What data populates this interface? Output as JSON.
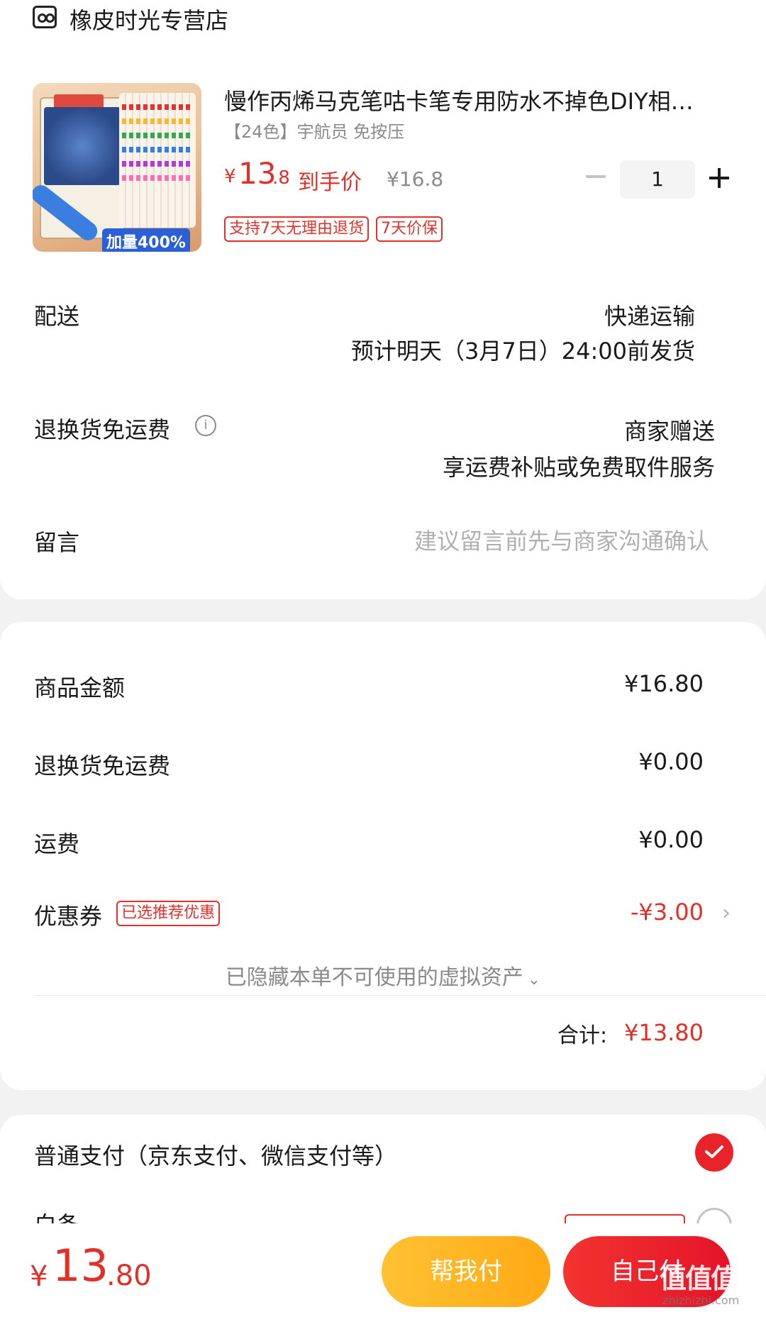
{
  "shop": {
    "name": "橡皮时光专营店",
    "icon": "shop-icon"
  },
  "product": {
    "title": "慢作丙烯马克笔咕卡笔专用防水不掉色DIY相…",
    "spec": "【24色】宇航员 免按压",
    "price_currency": "¥",
    "price_int": "13",
    "price_dec": ".8",
    "price_label": "到手价",
    "original_price": "¥16.8",
    "quantity": "1",
    "image_badge": "加量400%",
    "tags": [
      "支持7天无理由退货",
      "7天价保"
    ]
  },
  "delivery": {
    "label": "配送",
    "method": "快递运输",
    "eta": "预计明天（3月7日）24:00前发货"
  },
  "exchange_freight": {
    "label": "退换货免运费",
    "value": "商家赠送",
    "desc": "享运费补贴或免费取件服务"
  },
  "message": {
    "label": "留言",
    "placeholder": "建议留言前先与商家沟通确认"
  },
  "summary": {
    "goods_amount_label": "商品金额",
    "goods_amount_value": "¥16.80",
    "exchange_fee_label": "退换货免运费",
    "exchange_fee_value": "¥0.00",
    "shipping_label": "运费",
    "shipping_value": "¥0.00",
    "coupon_label": "优惠券",
    "coupon_tag": "已选推荐优惠",
    "coupon_value": "-¥3.00",
    "hidden_assets": "已隐藏本单不可使用的虚拟资产",
    "total_label": "合计:",
    "total_value": "¥13.80"
  },
  "payment": {
    "label": "普通支付（京东支付、微信支付等）",
    "partial_label": "白条"
  },
  "bottom_bar": {
    "currency": "¥",
    "amount_int": "13",
    "amount_dec": ".80",
    "help_pay_label": "帮我付",
    "self_pay_label": "自己付"
  },
  "watermark": {
    "main": "值值值",
    "sub": "zhizhizhi.com"
  },
  "colors": {
    "accent": "#e0302a",
    "help_pay": "#ffb522",
    "background": "#f2f2f2"
  }
}
